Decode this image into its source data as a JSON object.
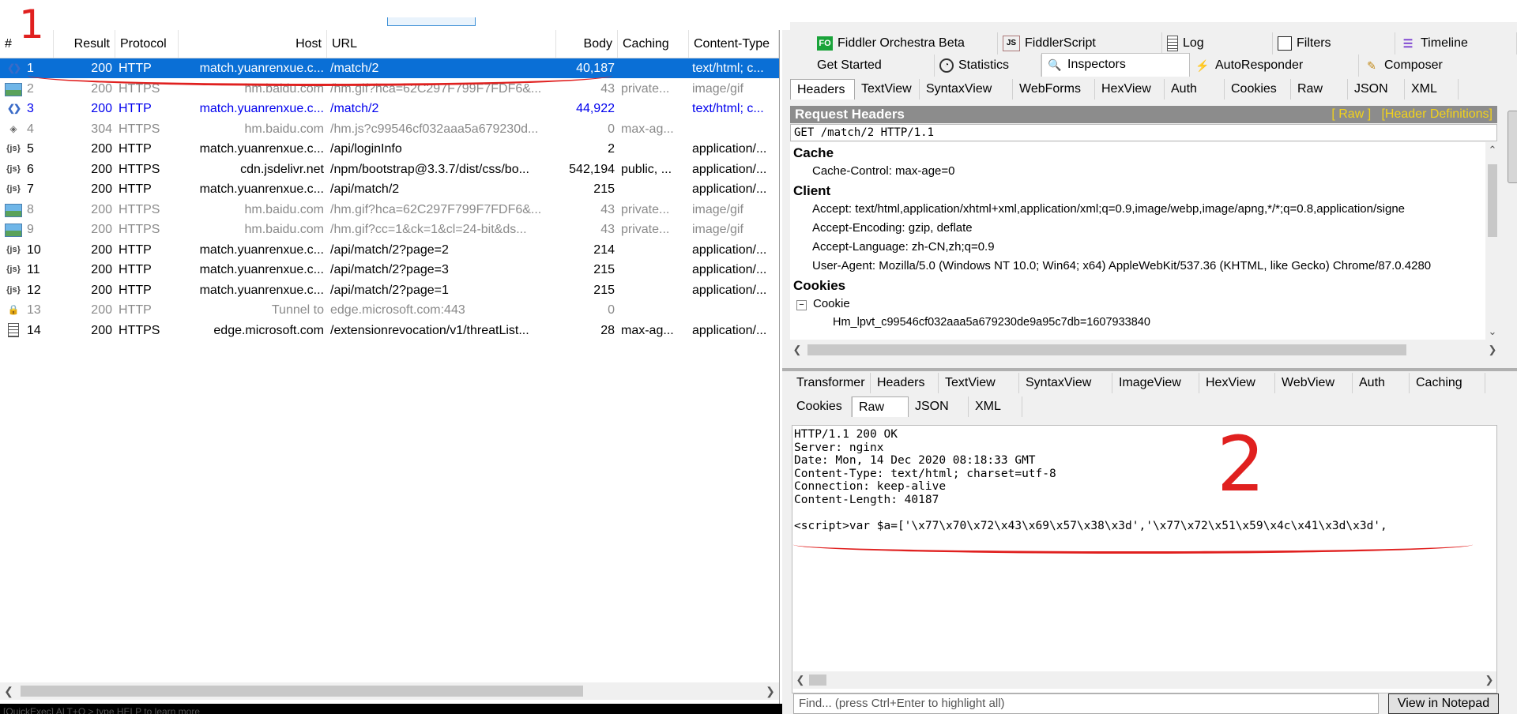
{
  "columns": [
    "#",
    "Result",
    "Protocol",
    "Host",
    "URL",
    "Body",
    "Caching",
    "Content-Type"
  ],
  "sessions": [
    {
      "id": "1",
      "result": "200",
      "protocol": "HTTP",
      "host": "match.yuanrenxue.c...",
      "url": "/match/2",
      "body": "40,187",
      "caching": "",
      "ctype": "text/html; c...",
      "icon": "html-icon",
      "style": "sel"
    },
    {
      "id": "2",
      "result": "200",
      "protocol": "HTTPS",
      "host": "hm.baidu.com",
      "url": "/hm.gif?hca=62C297F799F7FDF6&...",
      "body": "43",
      "caching": "private...",
      "ctype": "image/gif",
      "icon": "image-icon",
      "style": "gray"
    },
    {
      "id": "3",
      "result": "200",
      "protocol": "HTTP",
      "host": "match.yuanrenxue.c...",
      "url": "/match/2",
      "body": "44,922",
      "caching": "",
      "ctype": "text/html; c...",
      "icon": "html-icon",
      "style": "blue"
    },
    {
      "id": "4",
      "result": "304",
      "protocol": "HTTPS",
      "host": "hm.baidu.com",
      "url": "/hm.js?c99546cf032aaa5a679230d...",
      "body": "0",
      "caching": "max-ag...",
      "ctype": "",
      "icon": "not-modified-icon",
      "style": "gray"
    },
    {
      "id": "5",
      "result": "200",
      "protocol": "HTTP",
      "host": "match.yuanrenxue.c...",
      "url": "/api/loginInfo",
      "body": "2",
      "caching": "",
      "ctype": "application/...",
      "icon": "json-icon",
      "style": ""
    },
    {
      "id": "6",
      "result": "200",
      "protocol": "HTTPS",
      "host": "cdn.jsdelivr.net",
      "url": "/npm/bootstrap@3.3.7/dist/css/bo...",
      "body": "542,194",
      "caching": "public, ...",
      "ctype": "application/...",
      "icon": "json-icon",
      "style": ""
    },
    {
      "id": "7",
      "result": "200",
      "protocol": "HTTP",
      "host": "match.yuanrenxue.c...",
      "url": "/api/match/2",
      "body": "215",
      "caching": "",
      "ctype": "application/...",
      "icon": "json-icon",
      "style": ""
    },
    {
      "id": "8",
      "result": "200",
      "protocol": "HTTPS",
      "host": "hm.baidu.com",
      "url": "/hm.gif?hca=62C297F799F7FDF6&...",
      "body": "43",
      "caching": "private...",
      "ctype": "image/gif",
      "icon": "image-icon",
      "style": "gray"
    },
    {
      "id": "9",
      "result": "200",
      "protocol": "HTTPS",
      "host": "hm.baidu.com",
      "url": "/hm.gif?cc=1&ck=1&cl=24-bit&ds...",
      "body": "43",
      "caching": "private...",
      "ctype": "image/gif",
      "icon": "image-icon",
      "style": "gray"
    },
    {
      "id": "10",
      "result": "200",
      "protocol": "HTTP",
      "host": "match.yuanrenxue.c...",
      "url": "/api/match/2?page=2",
      "body": "214",
      "caching": "",
      "ctype": "application/...",
      "icon": "json-icon",
      "style": ""
    },
    {
      "id": "11",
      "result": "200",
      "protocol": "HTTP",
      "host": "match.yuanrenxue.c...",
      "url": "/api/match/2?page=3",
      "body": "215",
      "caching": "",
      "ctype": "application/...",
      "icon": "json-icon",
      "style": ""
    },
    {
      "id": "12",
      "result": "200",
      "protocol": "HTTP",
      "host": "match.yuanrenxue.c...",
      "url": "/api/match/2?page=1",
      "body": "215",
      "caching": "",
      "ctype": "application/...",
      "icon": "json-icon",
      "style": ""
    },
    {
      "id": "13",
      "result": "200",
      "protocol": "HTTP",
      "host": "Tunnel to",
      "url": "edge.microsoft.com:443",
      "body": "0",
      "caching": "",
      "ctype": "",
      "icon": "lock-icon",
      "style": "gray"
    },
    {
      "id": "14",
      "result": "200",
      "protocol": "HTTPS",
      "host": "edge.microsoft.com",
      "url": "/extensionrevocation/v1/threatList...",
      "body": "28",
      "caching": "max-ag...",
      "ctype": "application/...",
      "icon": "document-icon",
      "style": ""
    }
  ],
  "quickexec": "[QuickExec] ALT+Q > type HELP to learn more",
  "annotations": {
    "mark1": "1",
    "mark2": "2",
    "color": "#e0201f"
  },
  "top_tabs_row1": [
    {
      "label": "Fiddler Orchestra Beta",
      "icon": "fo-icon"
    },
    {
      "label": "FiddlerScript",
      "icon": "script-icon"
    },
    {
      "label": "Log",
      "icon": "log-icon"
    },
    {
      "label": "Filters",
      "icon": "filter-checkbox-icon"
    },
    {
      "label": "Timeline",
      "icon": "timeline-icon"
    }
  ],
  "top_tabs_row2": [
    {
      "label": "Get Started",
      "icon": ""
    },
    {
      "label": "Statistics",
      "icon": "stopwatch-icon"
    },
    {
      "label": "Inspectors",
      "icon": "inspector-icon"
    },
    {
      "label": "AutoResponder",
      "icon": "lightning-icon"
    },
    {
      "label": "Composer",
      "icon": "composer-icon"
    }
  ],
  "request_tabs": [
    "Headers",
    "TextView",
    "SyntaxView",
    "WebForms",
    "HexView",
    "Auth",
    "Cookies",
    "Raw",
    "JSON",
    "XML"
  ],
  "request_headers": {
    "title": "Request Headers",
    "raw_link": "[ Raw ]",
    "defs_link": "[Header Definitions]",
    "request_line": "GET /match/2 HTTP/1.1",
    "groups": {
      "cache": "Cache",
      "cache_control": "Cache-Control: max-age=0",
      "client": "Client",
      "accept": "Accept: text/html,application/xhtml+xml,application/xml;q=0.9,image/webp,image/apng,*/*;q=0.8,application/signe",
      "accept_encoding": "Accept-Encoding: gzip, deflate",
      "accept_language": "Accept-Language: zh-CN,zh;q=0.9",
      "user_agent": "User-Agent: Mozilla/5.0 (Windows NT 10.0; Win64; x64) AppleWebKit/537.36 (KHTML, like Gecko) Chrome/87.0.4280",
      "cookies": "Cookies",
      "cookie": "Cookie",
      "cookie_value": "Hm_lpvt_c99546cf032aaa5a679230de9a95c7db=1607933840"
    }
  },
  "response_tabs_row1": [
    "Transformer",
    "Headers",
    "TextView",
    "SyntaxView",
    "ImageView",
    "HexView",
    "WebView",
    "Auth",
    "Caching"
  ],
  "response_tabs_row2": [
    "Cookies",
    "Raw",
    "JSON",
    "XML"
  ],
  "response_text": "HTTP/1.1 200 OK\nServer: nginx\nDate: Mon, 14 Dec 2020 08:18:33 GMT\nContent-Type: text/html; charset=utf-8\nConnection: keep-alive\nContent-Length: 40187\n\n<script>var $a=['\\x77\\x70\\x72\\x43\\x69\\x57\\x38\\x3d','\\x77\\x72\\x51\\x59\\x4c\\x41\\x3d\\x3d',",
  "find_placeholder": "Find... (press Ctrl+Enter to highlight all)",
  "notepad_button": "View in Notepad"
}
